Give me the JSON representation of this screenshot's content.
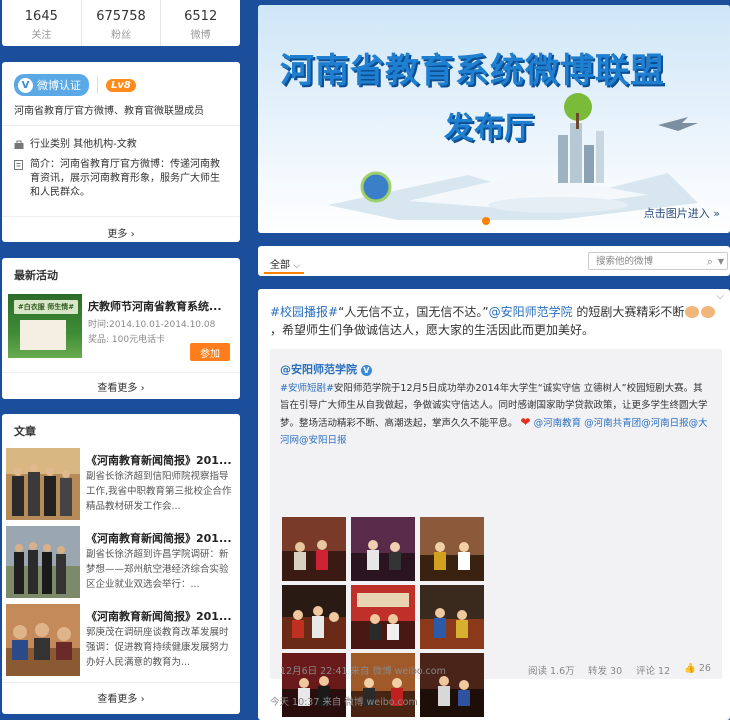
{
  "stats": [
    {
      "num": "1645",
      "label": "关注"
    },
    {
      "num": "675758",
      "label": "粉丝"
    },
    {
      "num": "6512",
      "label": "微博"
    }
  ],
  "profile": {
    "badge": "微博认证",
    "level": "Lv8",
    "desc": "河南省教育厅官方微博、教育官微联盟成员",
    "category": "行业类别 其他机构-文教",
    "intro": "简介：河南省教育厅官方微博：传递河南教育资讯，展示河南教育形象，服务广大师生和人民群众。",
    "more": "更多 ›"
  },
  "activity": {
    "heading": "最新活动",
    "title": "庆教师节河南省教育系统...",
    "time": "时间:2014.10.01-2014.10.08",
    "prize": "奖品: 100元电话卡",
    "join": "参加",
    "more": "查看更多 ›",
    "img_text": "#白衣服 师生情#"
  },
  "articles": {
    "heading": "文章",
    "items": [
      {
        "title": "《河南教育新闻简报》201...",
        "desc": "副省长徐济超到信阳师院视察指导工作,我省中职教育第三批校企合作精品教材研发工作会..."
      },
      {
        "title": "《河南教育新闻简报》201...",
        "desc": "副省长徐济超到许昌学院调研：新梦想——郑州航空港经济综合实验区企业就业双选会举行：..."
      },
      {
        "title": "《河南教育新闻简报》201...",
        "desc": "郭庚茂在调研座谈教育改革发展时强调：促进教育持续健康发展努力办好人民满意的教育为..."
      }
    ],
    "more": "查看更多 ›"
  },
  "banner": {
    "title": "河南省教育系统微博联盟",
    "subtitle": "发布厅",
    "link": "点击图片进入 »"
  },
  "feed": {
    "tab": "全部",
    "search_placeholder": "搜索他的微博"
  },
  "post": {
    "tag": "#校园播报#",
    "text1": "“人无信不立，国无信不达。”",
    "mention": "@安阳师范学院",
    "text2": " 的短剧大赛精彩不断",
    "text3": "，希望师生们争做诚信达人，愿大家的生活因此而更加美好。",
    "repost": {
      "name": "@安阳师范学院",
      "tag": "#安师短剧#",
      "text": "安阳师范学院于12月5日成功举办2014年大学生“诚实守信 立德树人”校园短剧大赛。其旨在引导广大师生从自我做起，争做诚实守信达人。同时感谢国家助学贷款政策，让更多学生终圆大学梦。整场活动精彩不断、高潮迭起，掌声久久不能平息。",
      "mentions": "@河南教育 @河南共青团@河南日报@大河网@安阳日报",
      "time": "12月6日 22:41 来自 微博 weibo.com",
      "reads": "阅读 1.6万",
      "reposts": "转发 30",
      "comments": "评论 12",
      "likes": "26"
    },
    "footer": "今天 10:37 来自 微博 weibo.com"
  }
}
